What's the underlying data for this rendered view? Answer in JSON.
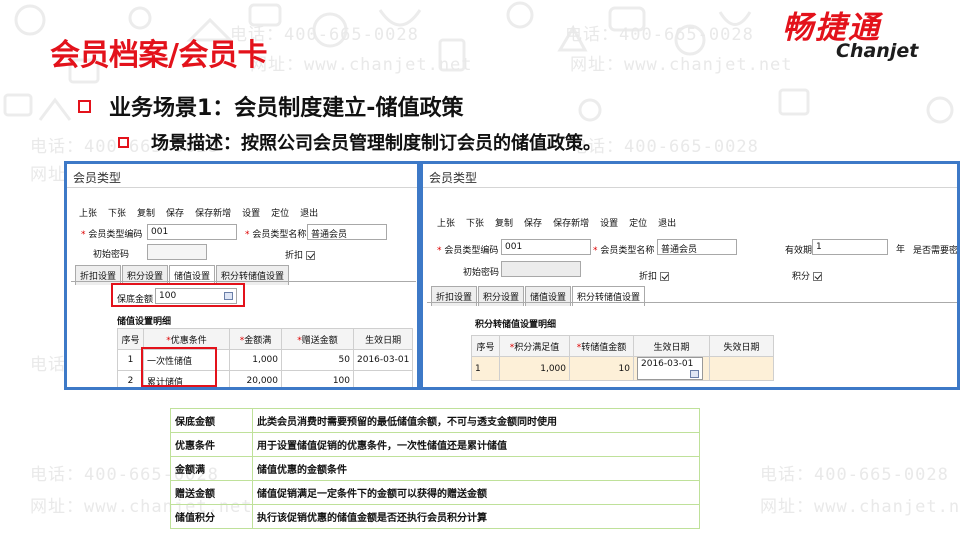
{
  "slide": {
    "title": "会员档案/会员卡",
    "bullet1": "业务场景1：会员制度建立-储值政策",
    "bullet2": "场景描述：按照公司会员管理制度制订会员的储值政策。"
  },
  "logo": {
    "cn": "畅捷通",
    "en": "Chanjet"
  },
  "watermark": {
    "phone": "电话：400-665-0028",
    "site": "网址：www.chanjet.net"
  },
  "left_window": {
    "title": "会员类型",
    "toolbar": [
      "上张",
      "下张",
      "复制",
      "保存",
      "保存新增",
      "设置",
      "定位",
      "退出"
    ],
    "code_label": "会员类型编码",
    "code_value": "001",
    "name_label": "会员类型名称",
    "name_value": "普通会员",
    "pwd_label": "初始密码",
    "discount_label": "折扣",
    "tabs": [
      "折扣设置",
      "积分设置",
      "储值设置",
      "积分转储值设置"
    ],
    "active_tab": 2,
    "min_balance_label": "保底金额",
    "min_balance_value": "100",
    "section_title": "储值设置明细",
    "columns": [
      "序号",
      "优惠条件",
      "金额满",
      "赠送金额",
      "生效日期"
    ],
    "rows": [
      [
        "1",
        "一次性储值",
        "1,000",
        "50",
        "2016-03-01"
      ],
      [
        "2",
        "累计储值",
        "20,000",
        "100",
        ""
      ]
    ]
  },
  "right_window": {
    "title": "会员类型",
    "toolbar": [
      "上张",
      "下张",
      "复制",
      "保存",
      "保存新增",
      "设置",
      "定位",
      "退出"
    ],
    "code_label": "会员类型编码",
    "code_value": "001",
    "name_label": "会员类型名称",
    "name_value": "普通会员",
    "validity_label": "有效期",
    "validity_value": "1",
    "validity_unit": "年",
    "renew_label": "是否需要密码",
    "pwd_label": "初始密码",
    "discount_label": "折扣",
    "points_label": "积分",
    "tabs": [
      "折扣设置",
      "积分设置",
      "储值设置",
      "积分转储值设置"
    ],
    "active_tab": 3,
    "section_title": "积分转储值设置明细",
    "columns": [
      "序号",
      "积分满足值",
      "转储值金额",
      "生效日期",
      "失效日期"
    ],
    "rows": [
      [
        "1",
        "1,000",
        "10",
        "2016-03-01",
        ""
      ]
    ]
  },
  "desc_table": [
    [
      "保底金额",
      "此类会员消费时需要预留的最低储值余额，不可与透支金额同时使用"
    ],
    [
      "优惠条件",
      "用于设置储值促销的优惠条件，一次性储值还是累计储值"
    ],
    [
      "金额满",
      "储值优惠的金额条件"
    ],
    [
      "赠送金额",
      "储值促销满足一定条件下的金额可以获得的赠送金额"
    ],
    [
      "储值积分",
      "执行该促销优惠的储值金额是否还执行会员积分计算"
    ]
  ]
}
